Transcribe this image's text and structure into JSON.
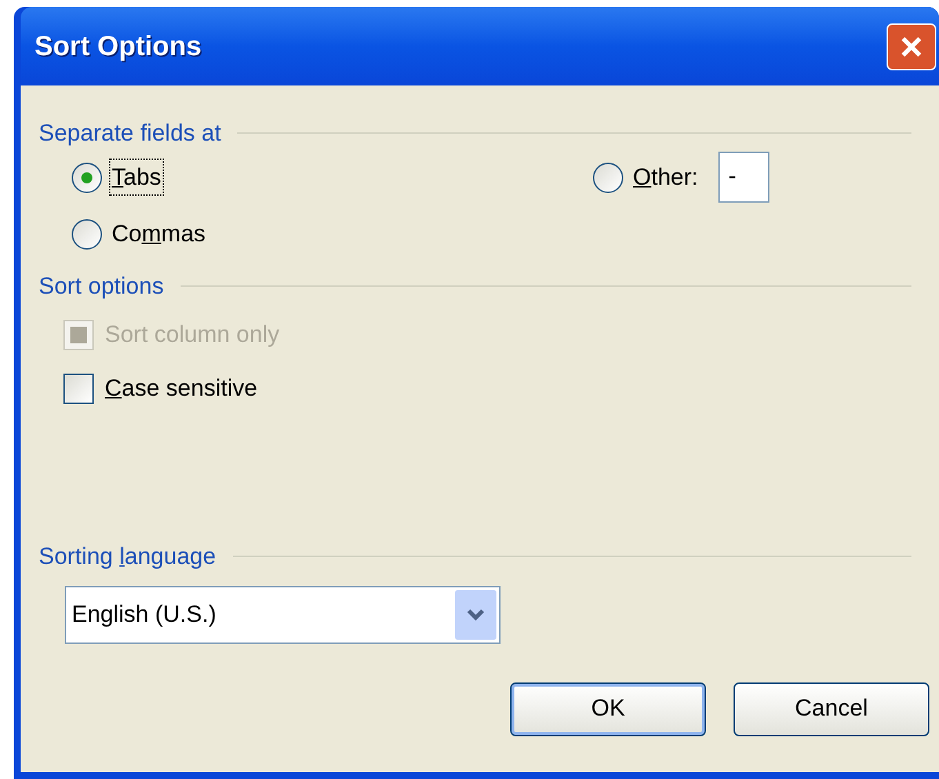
{
  "window": {
    "title": "Sort Options"
  },
  "separate_fields": {
    "heading": "Separate fields at",
    "options": [
      {
        "mnemonic": "T",
        "label_rest": "abs",
        "selected": true,
        "focused": true
      },
      {
        "label_start": "Co",
        "mnemonic": "m",
        "label_rest": "mas",
        "selected": false,
        "focused": false
      },
      {
        "mnemonic": "O",
        "label_rest": "ther:",
        "selected": false,
        "focused": false
      }
    ],
    "other_value": "-"
  },
  "sort_options": {
    "heading": "Sort options",
    "checkboxes": [
      {
        "label_start": "Sort column only",
        "checked": true,
        "disabled": true
      },
      {
        "mnemonic": "C",
        "label_rest": "ase sensitive",
        "checked": false,
        "disabled": false
      }
    ]
  },
  "sorting_language": {
    "heading_start": "Sorting ",
    "mnemonic": "l",
    "heading_rest": "anguage",
    "value": "English (U.S.)"
  },
  "buttons": [
    {
      "label": "OK"
    },
    {
      "label": "Cancel"
    }
  ]
}
